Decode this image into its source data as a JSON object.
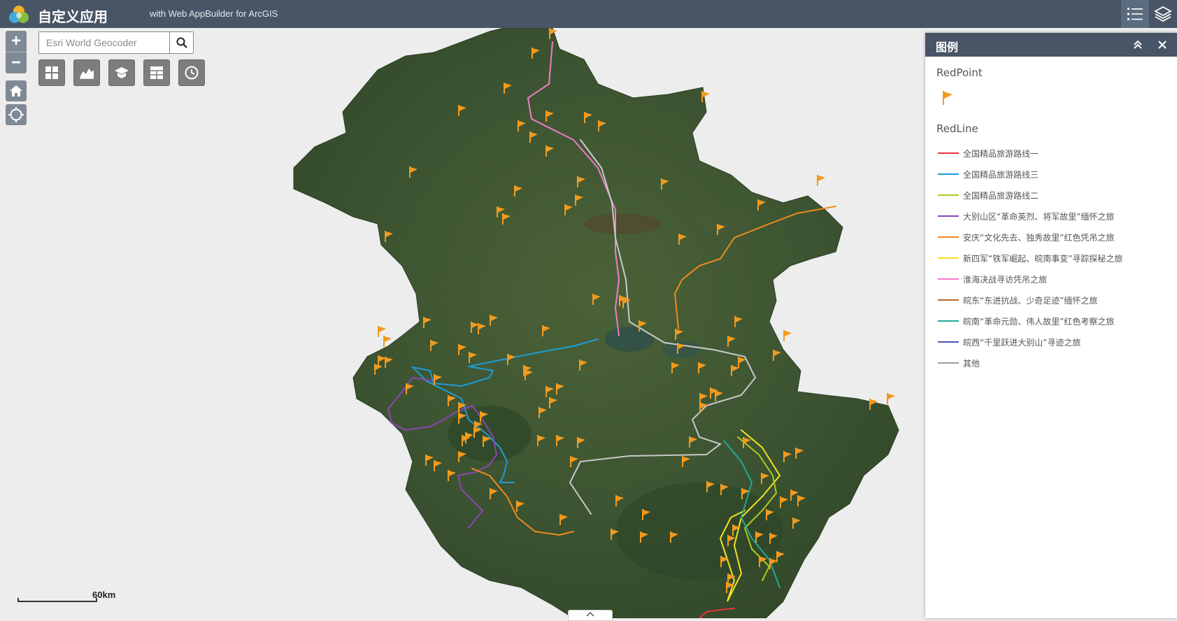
{
  "header": {
    "title": "自定义应用",
    "subtitle": "with Web AppBuilder for ArcGIS",
    "legend_icon": "legend-list-icon",
    "layers_icon": "layer-list-icon"
  },
  "search": {
    "placeholder": "Esri World Geocoder",
    "icon": "search-icon"
  },
  "zoom": {
    "in_label": "+",
    "out_label": "−"
  },
  "toolbar": {
    "items": [
      "grid-widget-icon",
      "chart-widget-icon",
      "education-widget-icon",
      "table-widget-icon",
      "history-widget-icon"
    ]
  },
  "scale": {
    "label": "60km"
  },
  "legend": {
    "title": "图例",
    "layers": [
      {
        "title": "RedPoint",
        "symbol": "flag-icon",
        "color": "#f39a1d"
      },
      {
        "title": "RedLine",
        "items": [
          {
            "label": "全国精品旅游路线一",
            "color": "#e8373a"
          },
          {
            "label": "全国精品旅游路线三",
            "color": "#1f9bd6"
          },
          {
            "label": "全国精品旅游路线二",
            "color": "#b2c920"
          },
          {
            "label": "大别山区“革命英烈、将军故里”缅怀之旅",
            "color": "#8c45b8"
          },
          {
            "label": "安庆“文化先去、独秀故里”红色凭吊之旅",
            "color": "#f08a1c"
          },
          {
            "label": "新四军“铁军崛起、皖南事变”寻踪探秘之旅",
            "color": "#f3e222"
          },
          {
            "label": "淮海决战寻访凭吊之旅",
            "color": "#f07cc7"
          },
          {
            "label": "皖东“东进抗战、少奇足迹”缅怀之旅",
            "color": "#b06a2a"
          },
          {
            "label": "皖南“革命元勋、伟人故里”红色考察之旅",
            "color": "#22a99a"
          },
          {
            "label": "皖西“千里跃进大别山”寻迹之旅",
            "color": "#4d52b8"
          },
          {
            "label": "其他",
            "color": "#9e9e9e"
          }
        ]
      }
    ]
  },
  "colors": {
    "header_bg": "#485566",
    "map_bg": "#ededed",
    "terrain": "#3c5433",
    "flag": "#f39a1d"
  }
}
